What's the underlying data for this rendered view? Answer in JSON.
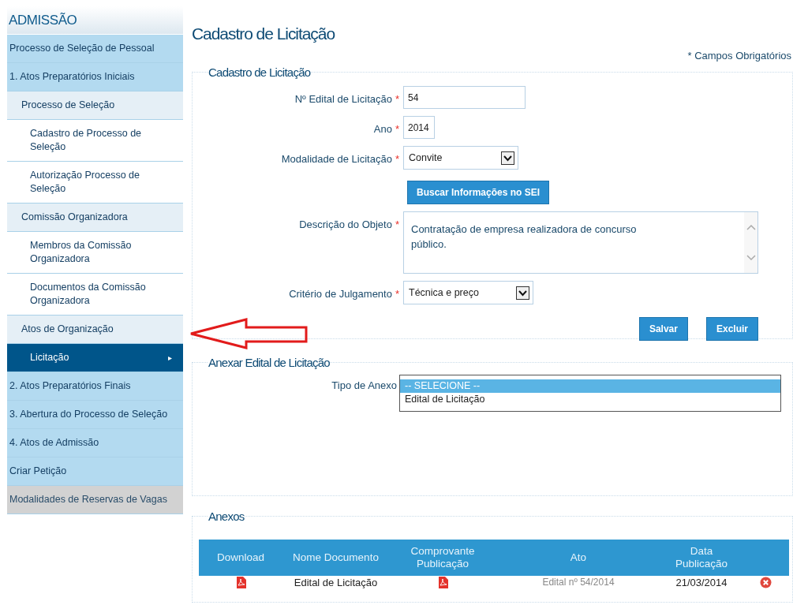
{
  "sidebar": {
    "title": "ADMISSÃO",
    "items": [
      {
        "label": "Processo de Seleção de Pessoal",
        "selected": false,
        "disabled": false
      },
      {
        "label": "1. Atos Preparatórios Iniciais",
        "selected": false,
        "disabled": false,
        "children": [
          {
            "label": "Processo de Seleção",
            "selected": false,
            "children": [
              {
                "label": "Cadastro de Processo de Seleção",
                "selected": false
              },
              {
                "label": "Autorização Processo de Seleção",
                "selected": false
              }
            ]
          },
          {
            "label": "Comissão Organizadora",
            "selected": false,
            "children": [
              {
                "label": "Membros da Comissão Organizadora",
                "selected": false
              },
              {
                "label": "Documentos da Comissão Organizadora",
                "selected": false
              }
            ]
          },
          {
            "label": "Atos de Organização",
            "selected": false,
            "children": [
              {
                "label": "Licitação",
                "selected": true,
                "caret": "▸"
              }
            ]
          }
        ]
      },
      {
        "label": "2. Atos Preparatórios Finais",
        "selected": false,
        "disabled": false
      },
      {
        "label": "3. Abertura do Processo de Seleção",
        "selected": false,
        "disabled": false
      },
      {
        "label": "4. Atos de Admissão",
        "selected": false,
        "disabled": false
      },
      {
        "label": "Criar Petição",
        "selected": false,
        "disabled": false
      },
      {
        "label": "Modalidades de Reservas de Vagas",
        "selected": false,
        "disabled": true
      }
    ]
  },
  "page_title": "Cadastro de Licitação",
  "required_note": "* Campos Obrigatórios",
  "form": {
    "legend": "Cadastro de Licitação",
    "fields": [
      {
        "kind": "text",
        "label": "Nº Edital de Licitação",
        "required_mark": "*",
        "value": "54"
      },
      {
        "kind": "text",
        "label": "Ano",
        "required_mark": "*",
        "value": "2014"
      },
      {
        "kind": "select",
        "label": "Modalidade de Licitação",
        "required_mark": "*",
        "value": "Convite"
      },
      {
        "kind": "button",
        "label": "Buscar Informações no SEI"
      },
      {
        "kind": "textarea",
        "label": "Descrição do Objeto",
        "required_mark": "*",
        "value": "Contratação de empresa realizadora de concurso público."
      },
      {
        "kind": "select",
        "label": "Critério de Julgamento",
        "required_mark": "*",
        "value": "Técnica e preço"
      }
    ],
    "buttons": [
      "Salvar",
      "Excluir"
    ]
  },
  "attach": {
    "legend": "Anexar Edital de Licitação",
    "label": "Tipo de Anexo",
    "options": [
      {
        "label": "-- SELECIONE --",
        "selected": true
      },
      {
        "label": "Edital de Licitação",
        "selected": false
      }
    ]
  },
  "attachments": {
    "legend": "Anexos",
    "columns": [
      "Download",
      "Nome Documento",
      "Comprovante Publicação",
      "Ato",
      "Data Publicação"
    ],
    "rows": [
      {
        "document": "Edital de Licitação",
        "act": "Edital nº 54/2014",
        "date": "21/03/2014"
      }
    ]
  }
}
